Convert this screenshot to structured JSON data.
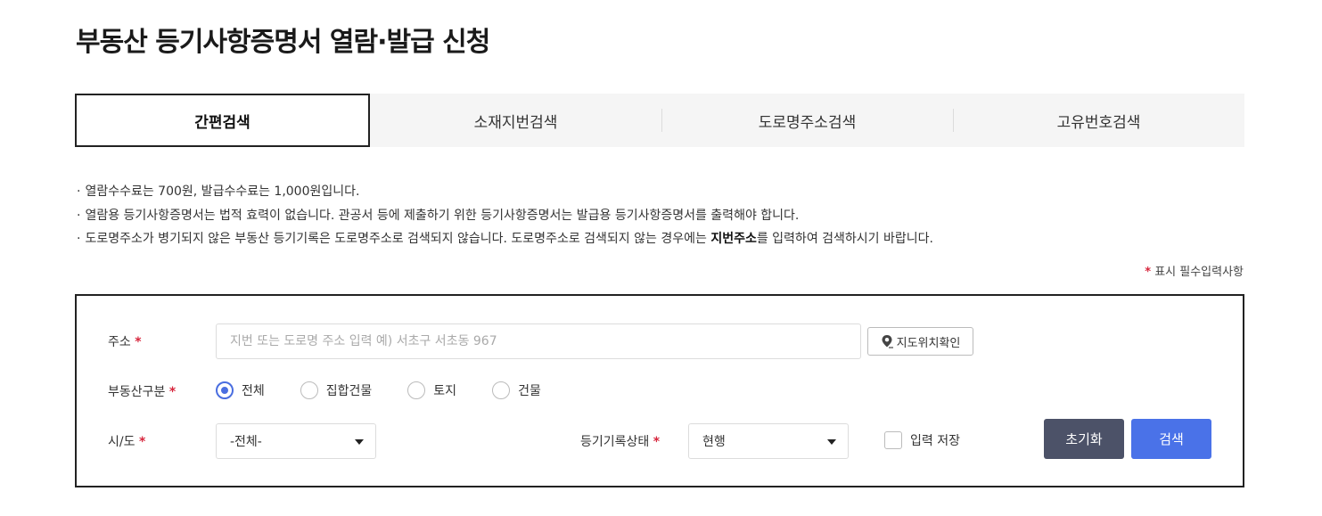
{
  "page": {
    "title": "부동산 등기사항증명서 열람·발급 신청"
  },
  "tabs": [
    {
      "label": "간편검색",
      "active": true
    },
    {
      "label": "소재지번검색",
      "active": false
    },
    {
      "label": "도로명주소검색",
      "active": false
    },
    {
      "label": "고유번호검색",
      "active": false
    }
  ],
  "notes": {
    "bullet": "·",
    "line1": "열람수수료는  700원, 발급수수료는  1,000원입니다.",
    "line2": "열람용 등기사항증명서는 법적 효력이 없습니다. 관공서 등에 제출하기 위한 등기사항증명서는 발급용 등기사항증명서를 출력해야 합니다.",
    "line3_pre": "도로명주소가 병기되지 않은 부동산 등기기록은 도로명주소로 검색되지 않습니다. 도로명주소로 검색되지 않는 경우에는 ",
    "line3_bold": "지번주소",
    "line3_post": "를 입력하여 검색하시기 바랍니다."
  },
  "required_note": {
    "star": "*",
    "text": "표시 필수입력사항"
  },
  "form": {
    "required_star": "*",
    "address": {
      "label": "주소",
      "value": "",
      "placeholder": "지번 또는 도로명 주소 입력 예) 서초구 서초동 967",
      "map_button": "지도위치확인"
    },
    "property_type": {
      "label": "부동산구분",
      "options": [
        {
          "label": "전체",
          "checked": true
        },
        {
          "label": "집합건물",
          "checked": false
        },
        {
          "label": "토지",
          "checked": false
        },
        {
          "label": "건물",
          "checked": false
        }
      ]
    },
    "sido": {
      "label": "시/도",
      "selected": "-전체-"
    },
    "record_status": {
      "label": "등기기록상태",
      "selected": "현행"
    },
    "save_input": {
      "label": "입력 저장",
      "checked": false
    },
    "reset_button": "초기화",
    "search_button": "검색"
  },
  "colors": {
    "accent": "#4a72e8",
    "reset": "#4c5268",
    "required": "#d7263d"
  }
}
